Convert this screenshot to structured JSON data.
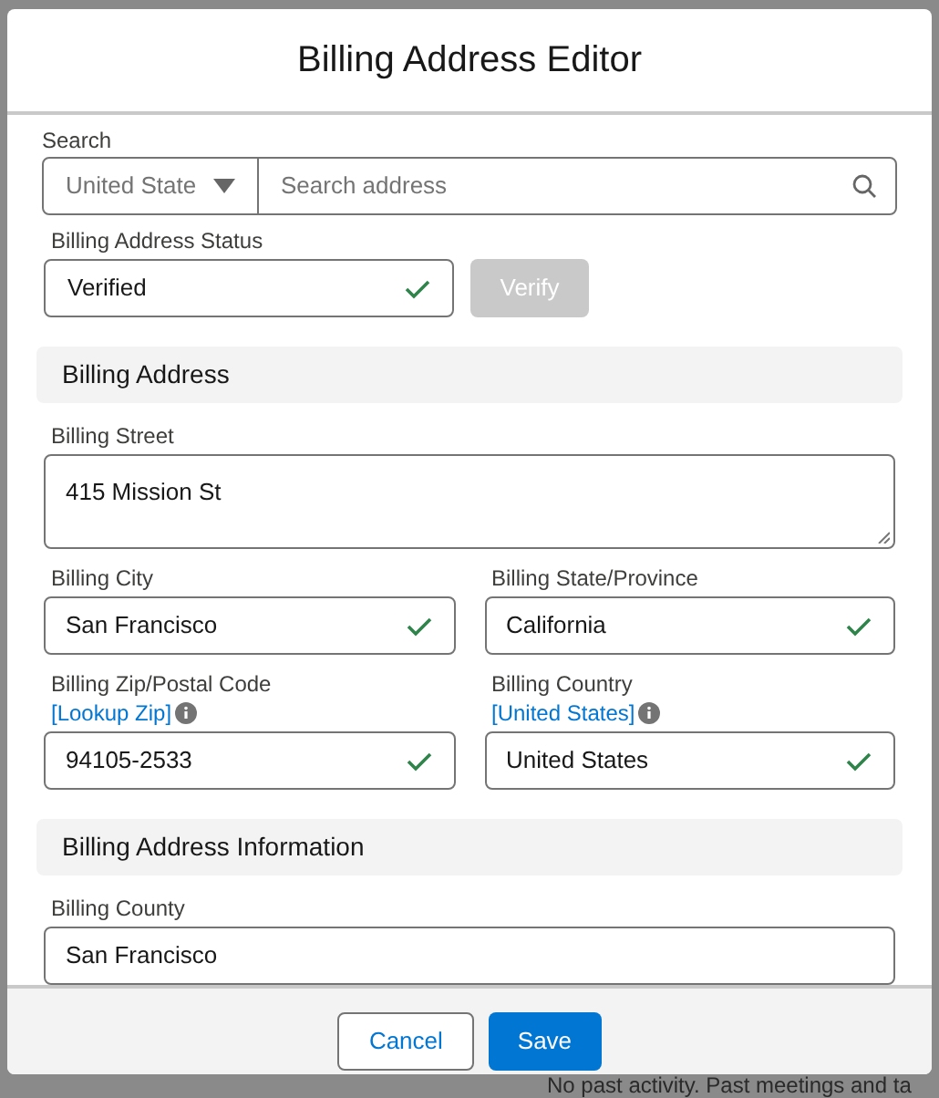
{
  "backdrop": {
    "text": "No past activity. Past meetings and ta"
  },
  "dialog": {
    "title": "Billing Address Editor"
  },
  "search": {
    "label": "Search",
    "country": "United State",
    "placeholder": "Search address"
  },
  "status": {
    "label": "Billing Address Status",
    "value": "Verified",
    "verified": true,
    "button": "Verify",
    "button_disabled": true
  },
  "sections": [
    {
      "title": "Billing Address",
      "rows": [
        [
          {
            "label": "Billing Street",
            "value": "415 Mission St",
            "kind": "textarea",
            "verified": false
          }
        ],
        [
          {
            "label": "Billing City",
            "value": "San Francisco",
            "kind": "input",
            "verified": true
          },
          {
            "label": "Billing State/Province",
            "value": "California",
            "kind": "input",
            "verified": true
          }
        ],
        [
          {
            "label": "Billing Zip/Postal Code",
            "link": "[Lookup Zip]",
            "value": "94105-2533",
            "kind": "input",
            "verified": true
          },
          {
            "label": "Billing Country",
            "link": "[United States]",
            "value": "United States",
            "kind": "input",
            "verified": true
          }
        ]
      ]
    },
    {
      "title": "Billing Address Information",
      "rows": [
        [
          {
            "label": "Billing County",
            "value": "San Francisco",
            "kind": "input",
            "verified": false
          }
        ]
      ]
    }
  ],
  "footer": {
    "buttons": [
      {
        "label": "Cancel",
        "kind": "secondary"
      },
      {
        "label": "Save",
        "kind": "primary"
      }
    ]
  }
}
